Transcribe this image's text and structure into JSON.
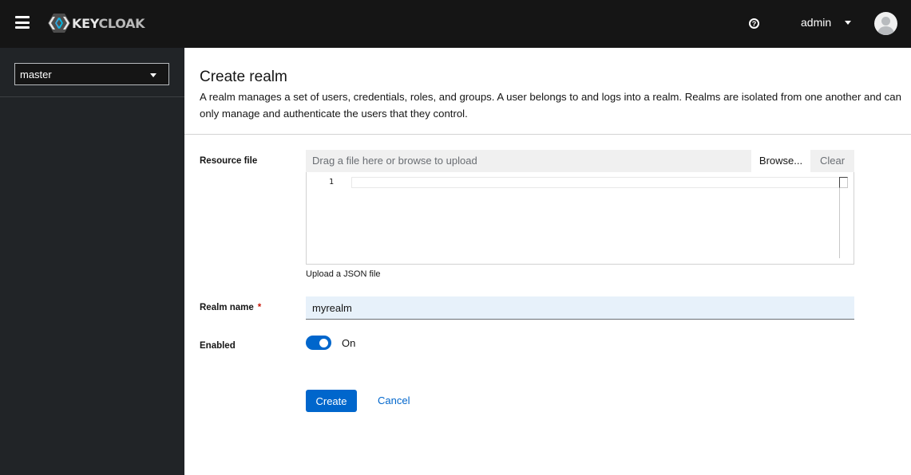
{
  "masthead": {
    "logo_text_first": "KEY",
    "logo_text_rest": "CLOAK",
    "help_icon": "question-circle-icon",
    "user_name": "admin",
    "avatar_icon": "user-avatar-icon",
    "menu_icon": "hamburger-icon"
  },
  "sidebar": {
    "realm_selected": "master"
  },
  "page": {
    "title": "Create realm",
    "description": "A realm manages a set of users, credentials, roles, and groups. A user belongs to and logs into a realm. Realms are isolated from one another and can only manage and authenticate the users that they control."
  },
  "form": {
    "resource_file": {
      "label": "Resource file",
      "placeholder": "Drag a file here or browse to upload",
      "browse_label": "Browse...",
      "clear_label": "Clear",
      "line_number": "1",
      "helper": "Upload a JSON file"
    },
    "realm_name": {
      "label": "Realm name",
      "required_mark": "*",
      "value": "myrealm"
    },
    "enabled": {
      "label": "Enabled",
      "state": "On",
      "checked": true
    },
    "create_label": "Create",
    "cancel_label": "Cancel"
  },
  "colors": {
    "masthead": "#151515",
    "sidebar": "#212427",
    "primary": "#0066cc",
    "required": "#c9190b",
    "input_bg": "#e7f1fa"
  }
}
